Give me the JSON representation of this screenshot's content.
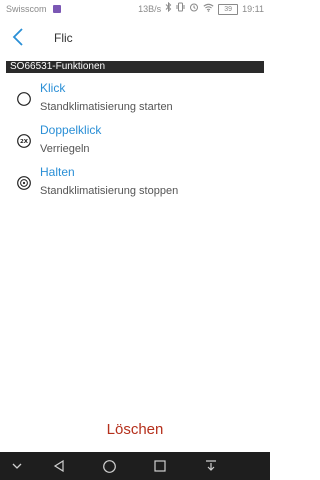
{
  "status_bar": {
    "carrier": "Swisscom",
    "speed": "13B/s",
    "battery": "39",
    "time": "19:11",
    "icons": [
      "bluetooth-icon",
      "vibrate-icon",
      "alarm-icon",
      "wifi-icon",
      "battery-icon"
    ]
  },
  "header": {
    "title": "Flic",
    "back_icon": "chevron-left-icon"
  },
  "section": {
    "title": "SO66531-Funktionen"
  },
  "actions": [
    {
      "title": "Klick",
      "description": "Standklimatisierung starten",
      "icon": "click-icon"
    },
    {
      "title": "Doppelklick",
      "description": "Verriegeln",
      "icon": "double-click-icon"
    },
    {
      "title": "Halten",
      "description": "Standklimatisierung stoppen",
      "icon": "hold-icon"
    }
  ],
  "delete_label": "Löschen",
  "double_click_badge": "2X",
  "nav_bar": [
    "dropdown-icon",
    "back-icon",
    "home-icon",
    "recents-icon",
    "notification-pull-icon"
  ],
  "colors": {
    "accent": "#2a8fd6",
    "delete": "#b5301c",
    "section_bg": "#2a2a2a",
    "nav_bg": "#1e1e1e"
  }
}
